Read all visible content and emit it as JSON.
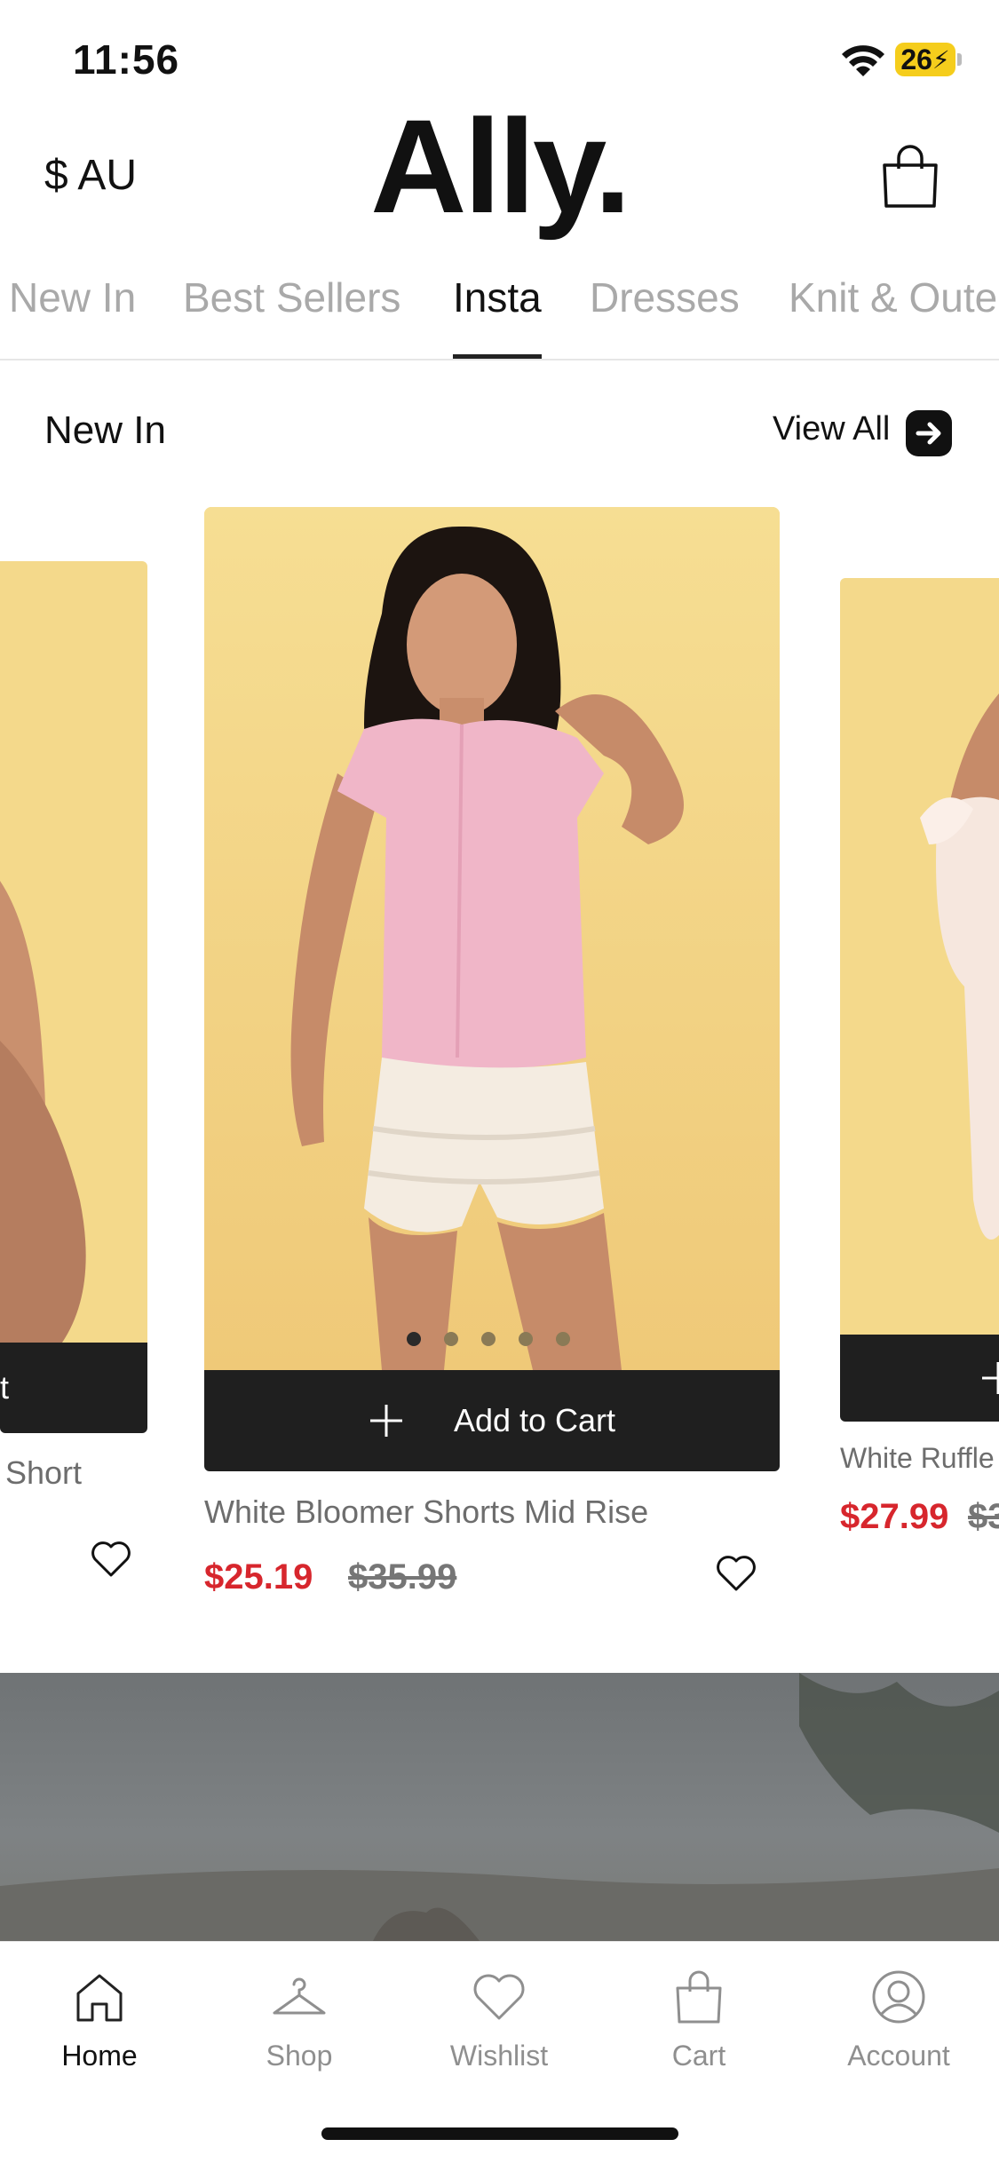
{
  "status_bar": {
    "time": "11:56",
    "battery": "26"
  },
  "header": {
    "currency": "$ AU",
    "logo": "Ally."
  },
  "tabs": [
    "New In",
    "Best Sellers",
    "Insta",
    "Dresses",
    "Knit & Outerwear"
  ],
  "active_tab": "Insta",
  "section": {
    "title": "New In",
    "view_all": "View All"
  },
  "products": [
    {
      "name": "Short",
      "add_to_cart": "t"
    },
    {
      "name": "White Bloomer Shorts Mid Rise",
      "sale_price": "$25.19",
      "original_price": "$35.99",
      "add_to_cart": "Add to Cart",
      "image_dots": 5,
      "active_dot": 1
    },
    {
      "name": "White Ruffle",
      "sale_price": "$27.99",
      "original_price": "$3"
    }
  ],
  "bottom_nav": [
    {
      "label": "Home",
      "icon": "home-icon",
      "active": true
    },
    {
      "label": "Shop",
      "icon": "hanger-icon",
      "active": false
    },
    {
      "label": "Wishlist",
      "icon": "heart-icon",
      "active": false
    },
    {
      "label": "Cart",
      "icon": "bag-icon",
      "active": false
    },
    {
      "label": "Account",
      "icon": "user-icon",
      "active": false
    }
  ],
  "colors": {
    "sale": "#d7262d",
    "dark": "#1f1f1f",
    "battery": "#f5cd1c",
    "image_bg": "#f4d98b"
  }
}
